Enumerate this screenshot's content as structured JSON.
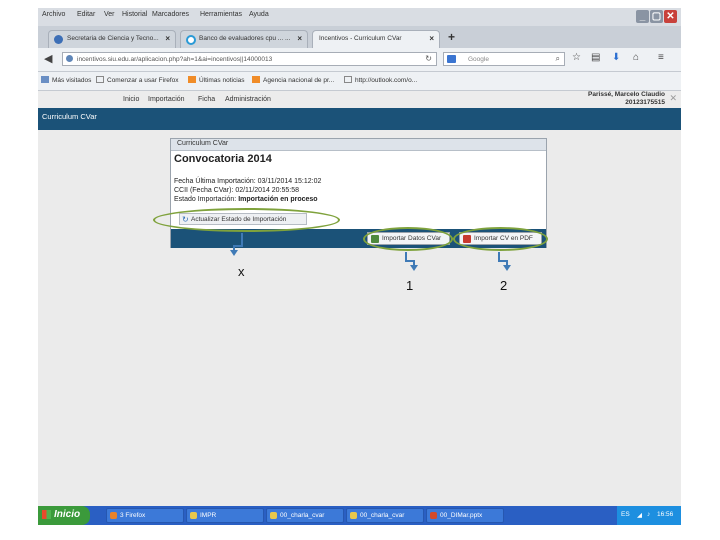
{
  "menubar": {
    "items": [
      "Archivo",
      "Editar",
      "Ver",
      "Historial",
      "Marcadores",
      "Herramientas",
      "Ayuda"
    ]
  },
  "tabs": [
    {
      "label": "Secretaria de Ciencia y Tecno...",
      "close": "×"
    },
    {
      "label": "Banco de evaluadores cpu ... ...",
      "close": "×"
    },
    {
      "label": "Incentivos - Curriculum CVar",
      "close": "×"
    }
  ],
  "new_tab": "+",
  "navbar": {
    "url": "incentivos.siu.edu.ar/aplicacion.php?ah=1&ai=incentivos||14000013",
    "search_placeholder": "Google"
  },
  "bookmarks": [
    "Más visitados",
    "Comenzar a usar Firefox",
    "Últimas noticias",
    "Agencia nacional de pr...",
    "http://outlook.com/o..."
  ],
  "site": {
    "nav": [
      "Inicio",
      "Importación",
      "Ficha",
      "Administración"
    ],
    "user_name": "Parissé, Marcelo Claudio",
    "user_id": "20123175515",
    "section_title": "Curriculum CVar"
  },
  "panel": {
    "header": "Curriculum CVar",
    "title": "Convocatoria 2014",
    "last_import": "Fecha Última Importación: 03/11/2014 15:12:02",
    "cvar_date": "CCII (Fecha CVar): 02/11/2014 20:55:58",
    "status_label": "Estado Importación: ",
    "status_value": "Importación en proceso",
    "refresh_button": "Actualizar Estado de Importación",
    "import_button": "Importar Datos CVar",
    "pdf_button": "Importar CV en PDF"
  },
  "annotations": {
    "x": "x",
    "one": "1",
    "two": "2"
  },
  "taskbar": {
    "start": "Inicio",
    "tasks": [
      "3 Firefox",
      "IMPR",
      "00_charla_cvar",
      "00_charla_cvar",
      "00_DIMar.pptx"
    ],
    "tray_lang": "ES",
    "clock": "16:56"
  },
  "colors": {
    "accent": "#1b5278",
    "ring": "#7fa23c"
  }
}
